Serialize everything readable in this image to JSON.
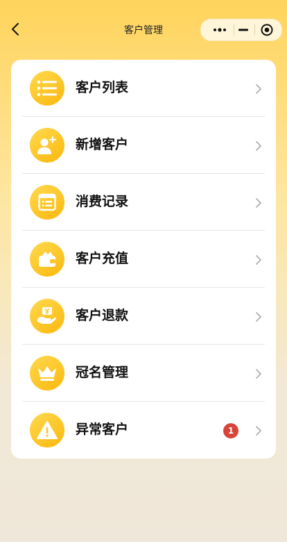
{
  "nav": {
    "title": "客户管理",
    "back_icon": "chevron-left-icon"
  },
  "capsule": {
    "more_icon": "more-dots-icon",
    "minimize_icon": "minimize-icon",
    "close_icon": "record-close-icon"
  },
  "menu": {
    "items": [
      {
        "label": "客户列表",
        "icon": "list-icon"
      },
      {
        "label": "新增客户",
        "icon": "add-user-icon"
      },
      {
        "label": "消费记录",
        "icon": "receipt-icon"
      },
      {
        "label": "客户充值",
        "icon": "wallet-icon"
      },
      {
        "label": "客户退款",
        "icon": "refund-hand-icon"
      },
      {
        "label": "冠名管理",
        "icon": "crown-icon"
      },
      {
        "label": "异常客户",
        "icon": "warning-icon",
        "badge": "1"
      }
    ]
  },
  "colors": {
    "accent": "#fbb80e",
    "badge": "#d9443a"
  }
}
